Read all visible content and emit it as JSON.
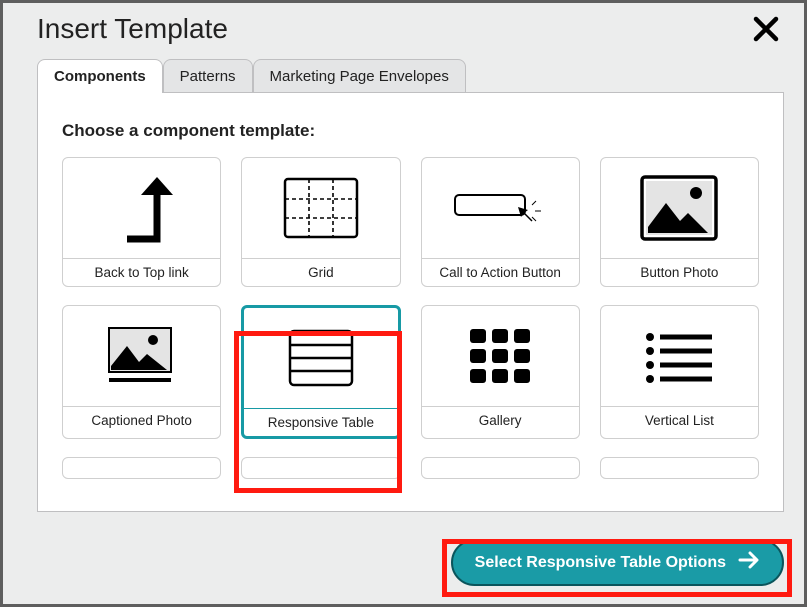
{
  "dialog": {
    "title": "Insert Template"
  },
  "tabs": [
    {
      "label": "Components",
      "active": true
    },
    {
      "label": "Patterns",
      "active": false
    },
    {
      "label": "Marketing Page Envelopes",
      "active": false
    }
  ],
  "prompt": "Choose a component template:",
  "components": [
    {
      "id": "back-to-top",
      "label": "Back to Top link",
      "icon": "arrow-up-turn"
    },
    {
      "id": "grid",
      "label": "Grid",
      "icon": "grid-3x3"
    },
    {
      "id": "cta-button",
      "label": "Call to Action Button",
      "icon": "button-click"
    },
    {
      "id": "button-photo",
      "label": "Button Photo",
      "icon": "photo-frame"
    },
    {
      "id": "captioned-photo",
      "label": "Captioned Photo",
      "icon": "photo-caption"
    },
    {
      "id": "responsive-table",
      "label": "Responsive Table",
      "icon": "table-rows",
      "selected": true
    },
    {
      "id": "gallery",
      "label": "Gallery",
      "icon": "gallery-grid"
    },
    {
      "id": "vertical-list",
      "label": "Vertical List",
      "icon": "bullet-list"
    }
  ],
  "cta_button": {
    "label": "Select Responsive Table Options"
  },
  "colors": {
    "accent": "#1a9ba6",
    "highlight": "#ff1a10"
  }
}
